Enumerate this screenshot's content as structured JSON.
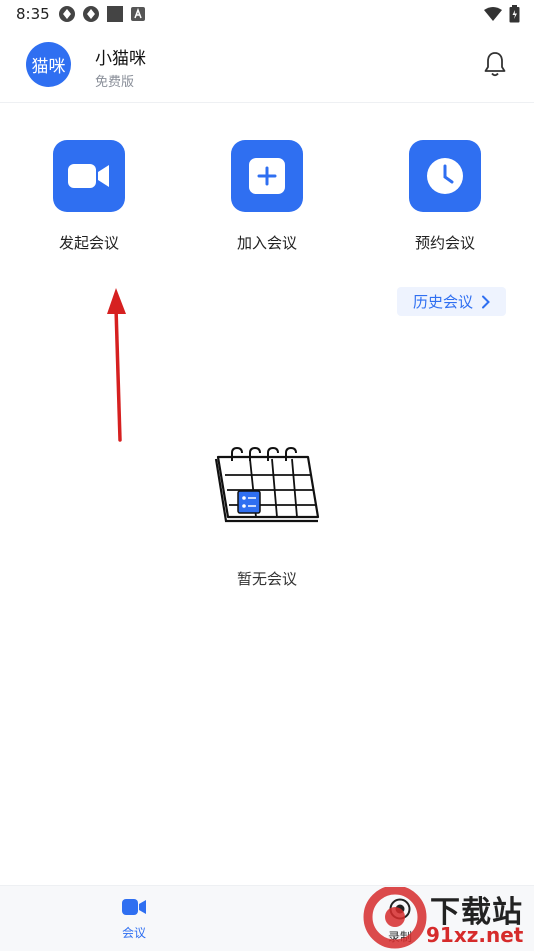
{
  "status_bar": {
    "time": "8:35"
  },
  "profile": {
    "avatar_text": "猫咪",
    "name": "小猫咪",
    "plan": "免费版"
  },
  "actions": [
    {
      "label": "发起会议",
      "icon": "video-camera-icon"
    },
    {
      "label": "加入会议",
      "icon": "plus-icon"
    },
    {
      "label": "预约会议",
      "icon": "clock-icon"
    }
  ],
  "history": {
    "label": "历史会议"
  },
  "empty_state": {
    "text": "暂无会议"
  },
  "tabs": [
    {
      "label": "会议",
      "icon": "video-camera-icon",
      "active": true
    },
    {
      "label": "录制",
      "icon": "record-icon",
      "active": false
    }
  ],
  "watermark": {
    "top": "下载站",
    "bottom": "91xz.net"
  },
  "colors": {
    "accent": "#2f6ff1",
    "annotation": "#d62020"
  }
}
